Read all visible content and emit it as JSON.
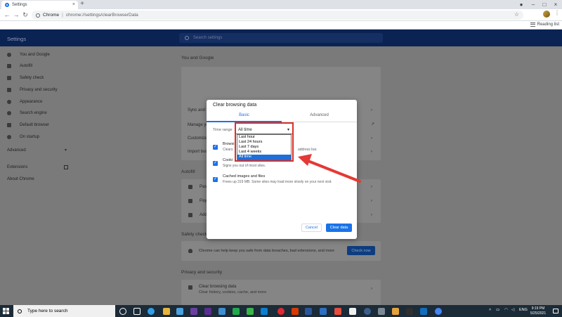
{
  "browser": {
    "tab_title": "Settings",
    "site_chip": "Chrome",
    "url": "chrome://settings/clearBrowserData",
    "reading_list": "Reading list"
  },
  "settings": {
    "title": "Settings",
    "search_placeholder": "Search settings",
    "sidebar": [
      {
        "label": "You and Google",
        "icon": "person-icon"
      },
      {
        "label": "Autofill",
        "icon": "autofill-icon"
      },
      {
        "label": "Safety check",
        "icon": "shield-icon"
      },
      {
        "label": "Privacy and security",
        "icon": "shield-lock-icon"
      },
      {
        "label": "Appearance",
        "icon": "palette-icon"
      },
      {
        "label": "Search engine",
        "icon": "search-icon"
      },
      {
        "label": "Default browser",
        "icon": "browser-icon"
      },
      {
        "label": "On startup",
        "icon": "power-icon"
      }
    ],
    "advanced": "Advanced",
    "extensions": "Extensions",
    "about": "About Chrome",
    "you_and_google": "You and Google",
    "rows_you": [
      "Sync and G",
      "Manage yo",
      "Customize",
      "Import boo"
    ],
    "autofill_title": "Autofill",
    "autofill_rows": [
      "Pas",
      "Pay",
      "Add"
    ],
    "safety_title": "Safety check",
    "safety_text": "Chrome can help keep you safe from data breaches, bad extensions, and more",
    "check_now": "Check now",
    "privacy_title": "Privacy and security",
    "cbd_title": "Clear browsing data",
    "cbd_sub": "Clear history, cookies, cache, and more"
  },
  "dialog": {
    "title": "Clear browsing data",
    "tabs": [
      "Basic",
      "Advanced"
    ],
    "time_range_label": "Time range",
    "time_range_value": "All time",
    "dropdown_options": [
      "Last hour",
      "Last 24 hours",
      "Last 7 days",
      "Last 4 weeks",
      "All time"
    ],
    "dropdown_selected": "All time",
    "options": [
      {
        "title": "Browsi",
        "desc": "Clears",
        "desc_tail": "address bar."
      },
      {
        "title": "Cooki",
        "desc": "Signs you out of most sites."
      },
      {
        "title": "Cached images and files",
        "desc": "Frees up 319 MB. Some sites may load more slowly on your next visit."
      }
    ],
    "cancel": "Cancel",
    "clear": "Clear data"
  },
  "taskbar": {
    "search_text": "Type here to search",
    "lang": "ENG",
    "time": "9:19 PM",
    "date": "5/25/2021"
  },
  "colors": {
    "accent": "#1a73e8",
    "annotation": "#d93025"
  }
}
